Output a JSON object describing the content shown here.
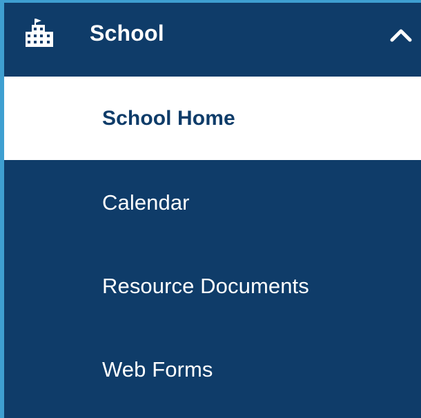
{
  "colors": {
    "panel": "#0f3c69",
    "accent_border": "#3e9fd1",
    "active_bg": "#ffffff",
    "text": "#ffffff",
    "active_text": "#0f3c69"
  },
  "header": {
    "icon": "building-icon",
    "title": "School",
    "toggle_icon": "chevron-up-icon"
  },
  "menu": {
    "items": [
      {
        "label": "School Home",
        "active": true
      },
      {
        "label": "Calendar",
        "active": false
      },
      {
        "label": "Resource Documents",
        "active": false
      },
      {
        "label": "Web Forms",
        "active": false
      }
    ]
  }
}
